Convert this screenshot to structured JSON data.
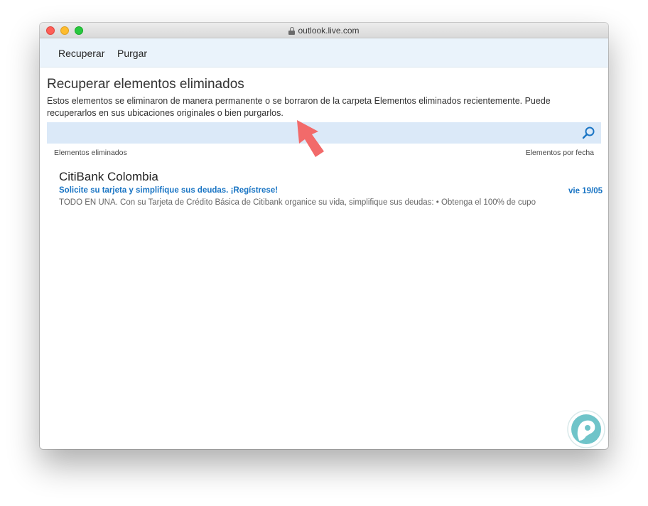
{
  "window": {
    "url": "outlook.live.com"
  },
  "toolbar": {
    "recover_label": "Recuperar",
    "purge_label": "Purgar"
  },
  "page": {
    "title": "Recuperar elementos eliminados",
    "description": "Estos elementos se eliminaron de manera permanente o se borraron de la carpeta Elementos eliminados recientemente. Puede recuperarlos en sus ubicaciones originales o bien purgarlos."
  },
  "search": {
    "value": "",
    "placeholder": ""
  },
  "list": {
    "header_left": "Elementos eliminados",
    "header_right": "Elementos por fecha",
    "items": [
      {
        "sender": "CitiBank Colombia",
        "subject": "Solicite su tarjeta y simplifique sus deudas. ¡Regístrese!",
        "preview": "TODO EN UNA. Con su Tarjeta de Crédito Básica de Citibank organice su vida, simplifique sus deudas: • Obtenga el 100% de cupo",
        "date": "vie 19/05"
      }
    ]
  },
  "colors": {
    "accent": "#1a75c4",
    "toolbar_bg": "#eaf3fb",
    "search_bg": "#dbe9f8",
    "annotation_arrow": "#f26a6a",
    "watermark_bg": "#6fc4c9"
  },
  "icons": [
    "lock-icon",
    "search-icon",
    "annotation-arrow-icon",
    "logo-watermark-icon"
  ]
}
